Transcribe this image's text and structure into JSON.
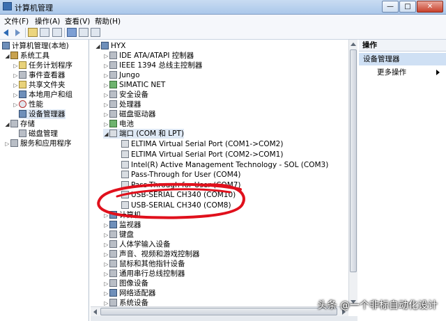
{
  "window": {
    "title": "计算机管理"
  },
  "menu": [
    "文件(F)",
    "操作(A)",
    "查看(V)",
    "帮助(H)"
  ],
  "left_tree": {
    "root": "计算机管理(本地)",
    "system_tools": "系统工具",
    "items": [
      "任务计划程序",
      "事件查看器",
      "共享文件夹",
      "本地用户和组",
      "性能",
      "设备管理器"
    ],
    "storage": "存储",
    "disk": "磁盘管理",
    "services": "服务和应用程序"
  },
  "device_tree": {
    "root": "HYX",
    "before_ports": [
      "IDE ATA/ATAPI 控制器",
      "IEEE 1394 总线主控制器",
      "Jungo",
      "SIMATIC NET",
      "安全设备",
      "处理器",
      "磁盘驱动器",
      "电池"
    ],
    "ports_label": "端口 (COM 和 LPT)",
    "ports": [
      "ELTIMA Virtual Serial Port (COM1->COM2)",
      "ELTIMA Virtual Serial Port (COM2->COM1)",
      "Intel(R) Active Management Technology - SOL (COM3)",
      "Pass-Through for User (COM4)",
      "Pass-Through for User (COM7)",
      "USB-SERIAL CH340 (COM10)",
      "USB-SERIAL CH340 (COM8)"
    ],
    "after_ports": [
      "计算机",
      "监视器",
      "键盘",
      "人体学输入设备",
      "声音、视频和游戏控制器",
      "鼠标和其他指针设备",
      "通用串行总线控制器",
      "图像设备",
      "网络适配器",
      "系统设备"
    ]
  },
  "actions": {
    "header": "操作",
    "section": "设备管理器",
    "more": "更多操作"
  },
  "watermark": "头条 @一个非标自动化设计",
  "colors": {
    "annotation_circle": "#e0101c",
    "selection": "#cfe0f4"
  }
}
